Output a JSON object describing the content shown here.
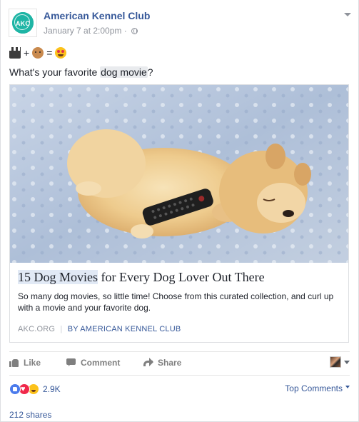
{
  "post": {
    "page_name": "American Kennel Club",
    "avatar_text": "AKC",
    "timestamp": "January 7 at 2:00pm",
    "privacy_icon": "globe-icon",
    "emoji_line": {
      "items": [
        "clapper-board-emoji",
        "dog-face-emoji",
        "heart-eyes-emoji"
      ],
      "plus": "+",
      "equals": "="
    },
    "text_before": "What's your favorite ",
    "text_highlight": "dog movie",
    "text_after": "?"
  },
  "link": {
    "title_highlight": "15 Dog Movies",
    "title_rest": " for Every Dog Lover Out There",
    "description": "So many dog movies, so little time! Choose from this curated collection, and curl up with a movie and your favorite dog.",
    "domain": "AKC.ORG",
    "separator": "|",
    "byline": "BY AMERICAN KENNEL CLUB"
  },
  "actions": {
    "like": "Like",
    "comment": "Comment",
    "share": "Share"
  },
  "reactions": {
    "count": "2.9K",
    "top_comments": "Top Comments",
    "shares": "212 shares"
  },
  "colors": {
    "link_blue": "#365899",
    "brand_teal": "#1fb5a5",
    "muted": "#90949c"
  }
}
